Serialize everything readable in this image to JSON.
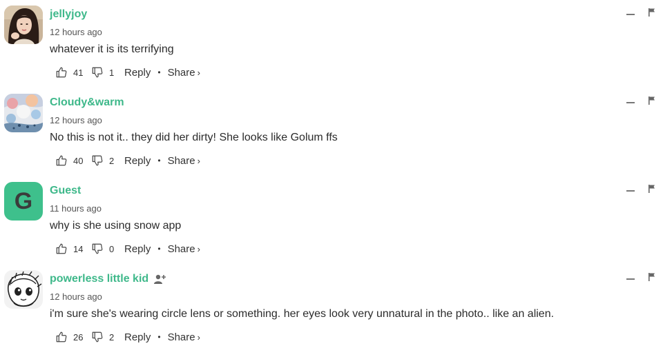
{
  "colors": {
    "username": "#3eb88a",
    "guest_avatar_bg": "#3ec08c"
  },
  "labels": {
    "reply": "Reply",
    "share": "Share",
    "share_chevron": "›",
    "separator": "•"
  },
  "comments": [
    {
      "username": "jellyjoy",
      "timestamp": "12 hours ago",
      "text": "whatever it is its terrifying",
      "upvotes": "41",
      "downvotes": "1",
      "avatar": "photo-avatar"
    },
    {
      "username": "Cloudy&warm",
      "timestamp": "12 hours ago",
      "text": "No this is not it.. they did her dirty! She looks like Golum ffs",
      "upvotes": "40",
      "downvotes": "2",
      "avatar": "painting-avatar"
    },
    {
      "username": "Guest",
      "timestamp": "11 hours ago",
      "text": "why is she using snow app",
      "upvotes": "14",
      "downvotes": "0",
      "avatar": "letter-avatar",
      "avatar_letter": "G"
    },
    {
      "username": "powerless little kid",
      "timestamp": "12 hours ago",
      "text": "i'm sure she's wearing circle lens or something. her eyes look very unnatural in the photo.. like an alien.",
      "upvotes": "26",
      "downvotes": "2",
      "avatar": "sketch-avatar",
      "follow_icon": "add-person-icon"
    }
  ]
}
